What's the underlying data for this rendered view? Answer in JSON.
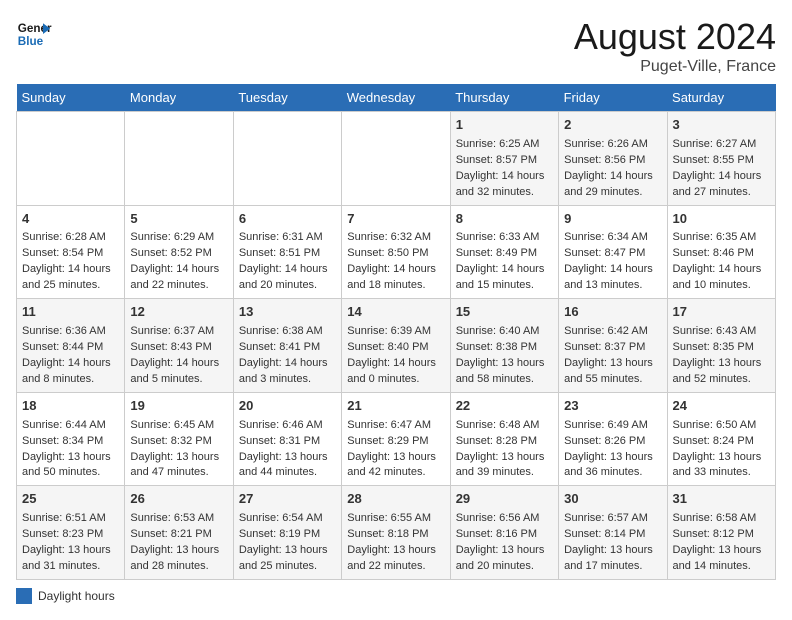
{
  "header": {
    "logo_line1": "General",
    "logo_line2": "Blue",
    "month_year": "August 2024",
    "location": "Puget-Ville, France"
  },
  "days_of_week": [
    "Sunday",
    "Monday",
    "Tuesday",
    "Wednesday",
    "Thursday",
    "Friday",
    "Saturday"
  ],
  "weeks": [
    [
      {
        "day": "",
        "info": ""
      },
      {
        "day": "",
        "info": ""
      },
      {
        "day": "",
        "info": ""
      },
      {
        "day": "",
        "info": ""
      },
      {
        "day": "1",
        "info": "Sunrise: 6:25 AM\nSunset: 8:57 PM\nDaylight: 14 hours and 32 minutes."
      },
      {
        "day": "2",
        "info": "Sunrise: 6:26 AM\nSunset: 8:56 PM\nDaylight: 14 hours and 29 minutes."
      },
      {
        "day": "3",
        "info": "Sunrise: 6:27 AM\nSunset: 8:55 PM\nDaylight: 14 hours and 27 minutes."
      }
    ],
    [
      {
        "day": "4",
        "info": "Sunrise: 6:28 AM\nSunset: 8:54 PM\nDaylight: 14 hours and 25 minutes."
      },
      {
        "day": "5",
        "info": "Sunrise: 6:29 AM\nSunset: 8:52 PM\nDaylight: 14 hours and 22 minutes."
      },
      {
        "day": "6",
        "info": "Sunrise: 6:31 AM\nSunset: 8:51 PM\nDaylight: 14 hours and 20 minutes."
      },
      {
        "day": "7",
        "info": "Sunrise: 6:32 AM\nSunset: 8:50 PM\nDaylight: 14 hours and 18 minutes."
      },
      {
        "day": "8",
        "info": "Sunrise: 6:33 AM\nSunset: 8:49 PM\nDaylight: 14 hours and 15 minutes."
      },
      {
        "day": "9",
        "info": "Sunrise: 6:34 AM\nSunset: 8:47 PM\nDaylight: 14 hours and 13 minutes."
      },
      {
        "day": "10",
        "info": "Sunrise: 6:35 AM\nSunset: 8:46 PM\nDaylight: 14 hours and 10 minutes."
      }
    ],
    [
      {
        "day": "11",
        "info": "Sunrise: 6:36 AM\nSunset: 8:44 PM\nDaylight: 14 hours and 8 minutes."
      },
      {
        "day": "12",
        "info": "Sunrise: 6:37 AM\nSunset: 8:43 PM\nDaylight: 14 hours and 5 minutes."
      },
      {
        "day": "13",
        "info": "Sunrise: 6:38 AM\nSunset: 8:41 PM\nDaylight: 14 hours and 3 minutes."
      },
      {
        "day": "14",
        "info": "Sunrise: 6:39 AM\nSunset: 8:40 PM\nDaylight: 14 hours and 0 minutes."
      },
      {
        "day": "15",
        "info": "Sunrise: 6:40 AM\nSunset: 8:38 PM\nDaylight: 13 hours and 58 minutes."
      },
      {
        "day": "16",
        "info": "Sunrise: 6:42 AM\nSunset: 8:37 PM\nDaylight: 13 hours and 55 minutes."
      },
      {
        "day": "17",
        "info": "Sunrise: 6:43 AM\nSunset: 8:35 PM\nDaylight: 13 hours and 52 minutes."
      }
    ],
    [
      {
        "day": "18",
        "info": "Sunrise: 6:44 AM\nSunset: 8:34 PM\nDaylight: 13 hours and 50 minutes."
      },
      {
        "day": "19",
        "info": "Sunrise: 6:45 AM\nSunset: 8:32 PM\nDaylight: 13 hours and 47 minutes."
      },
      {
        "day": "20",
        "info": "Sunrise: 6:46 AM\nSunset: 8:31 PM\nDaylight: 13 hours and 44 minutes."
      },
      {
        "day": "21",
        "info": "Sunrise: 6:47 AM\nSunset: 8:29 PM\nDaylight: 13 hours and 42 minutes."
      },
      {
        "day": "22",
        "info": "Sunrise: 6:48 AM\nSunset: 8:28 PM\nDaylight: 13 hours and 39 minutes."
      },
      {
        "day": "23",
        "info": "Sunrise: 6:49 AM\nSunset: 8:26 PM\nDaylight: 13 hours and 36 minutes."
      },
      {
        "day": "24",
        "info": "Sunrise: 6:50 AM\nSunset: 8:24 PM\nDaylight: 13 hours and 33 minutes."
      }
    ],
    [
      {
        "day": "25",
        "info": "Sunrise: 6:51 AM\nSunset: 8:23 PM\nDaylight: 13 hours and 31 minutes."
      },
      {
        "day": "26",
        "info": "Sunrise: 6:53 AM\nSunset: 8:21 PM\nDaylight: 13 hours and 28 minutes."
      },
      {
        "day": "27",
        "info": "Sunrise: 6:54 AM\nSunset: 8:19 PM\nDaylight: 13 hours and 25 minutes."
      },
      {
        "day": "28",
        "info": "Sunrise: 6:55 AM\nSunset: 8:18 PM\nDaylight: 13 hours and 22 minutes."
      },
      {
        "day": "29",
        "info": "Sunrise: 6:56 AM\nSunset: 8:16 PM\nDaylight: 13 hours and 20 minutes."
      },
      {
        "day": "30",
        "info": "Sunrise: 6:57 AM\nSunset: 8:14 PM\nDaylight: 13 hours and 17 minutes."
      },
      {
        "day": "31",
        "info": "Sunrise: 6:58 AM\nSunset: 8:12 PM\nDaylight: 13 hours and 14 minutes."
      }
    ]
  ],
  "legend": {
    "label": "Daylight hours"
  }
}
